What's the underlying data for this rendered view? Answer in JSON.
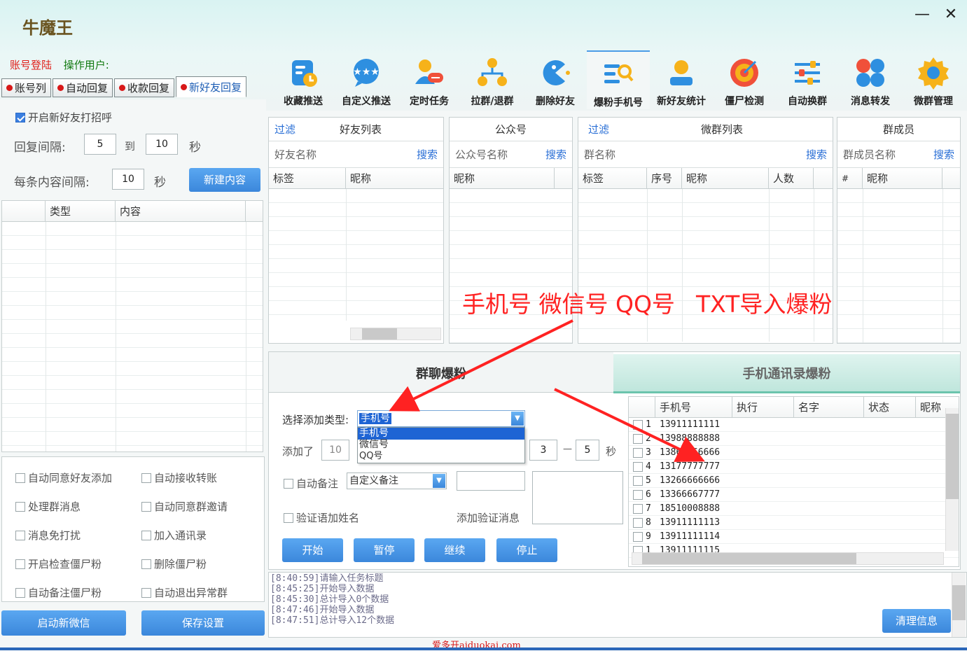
{
  "app": {
    "title": "牛魔王",
    "minimize": "—",
    "close": "✕"
  },
  "login": {
    "account_login": "账号登陆",
    "operator": "操作用户:"
  },
  "left_tabs": [
    {
      "label": "账号列",
      "active": false
    },
    {
      "label": "自动回复",
      "active": false
    },
    {
      "label": "收款回复",
      "active": false
    },
    {
      "label": "新好友回复",
      "active": true
    }
  ],
  "toolbar": [
    {
      "label": "收藏推送",
      "icon": "favorites-push-icon"
    },
    {
      "label": "自定义推送",
      "icon": "custom-push-icon"
    },
    {
      "label": "定时任务",
      "icon": "scheduled-task-icon"
    },
    {
      "label": "拉群/退群",
      "icon": "group-join-leave-icon"
    },
    {
      "label": "删除好友",
      "icon": "delete-friend-icon"
    },
    {
      "label": "爆粉手机号",
      "icon": "phone-growth-icon",
      "active": true
    },
    {
      "label": "新好友统计",
      "icon": "new-friend-stats-icon"
    },
    {
      "label": "僵尸检测",
      "icon": "zombie-detect-icon"
    },
    {
      "label": "自动换群",
      "icon": "auto-switch-group-icon"
    },
    {
      "label": "消息转发",
      "icon": "message-forward-icon"
    },
    {
      "label": "微群管理",
      "icon": "group-manage-icon"
    }
  ],
  "new_friend": {
    "enable_greeting": "开启新好友打招呼",
    "reply_interval_label": "回复间隔:",
    "reply_from": "5",
    "to_label": "到",
    "reply_to": "10",
    "sec_label": "秒",
    "content_interval_label": "每条内容间隔:",
    "content_interval": "10",
    "new_content_button": "新建内容",
    "table_headers": [
      "类型",
      "内容"
    ]
  },
  "options_left": [
    "自动同意好友添加",
    "处理群消息",
    "消息免打扰",
    "开启检查僵尸粉",
    "自动备注僵尸粉"
  ],
  "options_right": [
    "自动接收转账",
    "自动同意群邀请",
    "加入通讯录",
    "删除僵尸粉",
    "自动退出异常群"
  ],
  "bottom_buttons": {
    "start_wechat": "启动新微信",
    "save_settings": "保存设置"
  },
  "friends_panel": {
    "filter": "过滤",
    "title": "好友列表",
    "name_label": "好友名称",
    "search": "搜索",
    "headers": [
      "标签",
      "昵称"
    ]
  },
  "official_panel": {
    "title": "公众号",
    "name_label": "公众号名称",
    "search": "搜索",
    "headers": [
      "昵称"
    ]
  },
  "groups_panel": {
    "filter": "过滤",
    "title": "微群列表",
    "name_label": "群名称",
    "search": "搜索",
    "headers": [
      "标签",
      "序号",
      "昵称",
      "人数"
    ]
  },
  "members_panel": {
    "title": "群成员",
    "name_label": "群成员名称",
    "search": "搜索",
    "headers": [
      "#",
      "昵称"
    ]
  },
  "annotation": {
    "left": "手机号 微信号 QQ号",
    "right": "TXT导入爆粉",
    "color": "#ff2222"
  },
  "sub_tabs": {
    "group_growth": "群聊爆粉",
    "contacts_growth": "手机通讯录爆粉"
  },
  "growth_form": {
    "type_label": "选择添加类型:",
    "type_value": "手机号",
    "type_options": [
      "手机号",
      "微信号",
      "QQ号"
    ],
    "added_label": "添加了",
    "added_value": "10",
    "interval_from": "3",
    "dash": "—",
    "interval_to": "5",
    "sec_label": "秒",
    "auto_remark_label": "自动备注",
    "auto_remark_value": "自定义备注",
    "verify_name_label": "验证语加姓名",
    "verify_msg_label": "添加验证消息",
    "buttons": {
      "start": "开始",
      "pause": "暂停",
      "resume": "继续",
      "stop": "停止"
    }
  },
  "phone_table": {
    "headers": [
      "手机号",
      "执行",
      "名字",
      "状态",
      "昵称"
    ],
    "rows": [
      {
        "n": "1",
        "phone": "13911111111"
      },
      {
        "n": "2",
        "phone": "13988888888"
      },
      {
        "n": "3",
        "phone": "13866666666"
      },
      {
        "n": "4",
        "phone": "13177777777"
      },
      {
        "n": "5",
        "phone": "13266666666"
      },
      {
        "n": "6",
        "phone": "13366667777"
      },
      {
        "n": "7",
        "phone": "18510008888"
      },
      {
        "n": "8",
        "phone": "13911111113"
      },
      {
        "n": "9",
        "phone": "13911111114"
      },
      {
        "n": "1",
        "phone": "13911111115"
      }
    ]
  },
  "log": {
    "lines": [
      "[8:40:59]请输入任务标题",
      "[8:45:25]开始导入数据",
      "[8:45:30]总计导入0个数据",
      "[8:47:46]开始导入数据",
      "[8:47:51]总计导入12个数据"
    ],
    "clear_button": "清理信息"
  },
  "watermark": "爱多开aiduokai.com"
}
